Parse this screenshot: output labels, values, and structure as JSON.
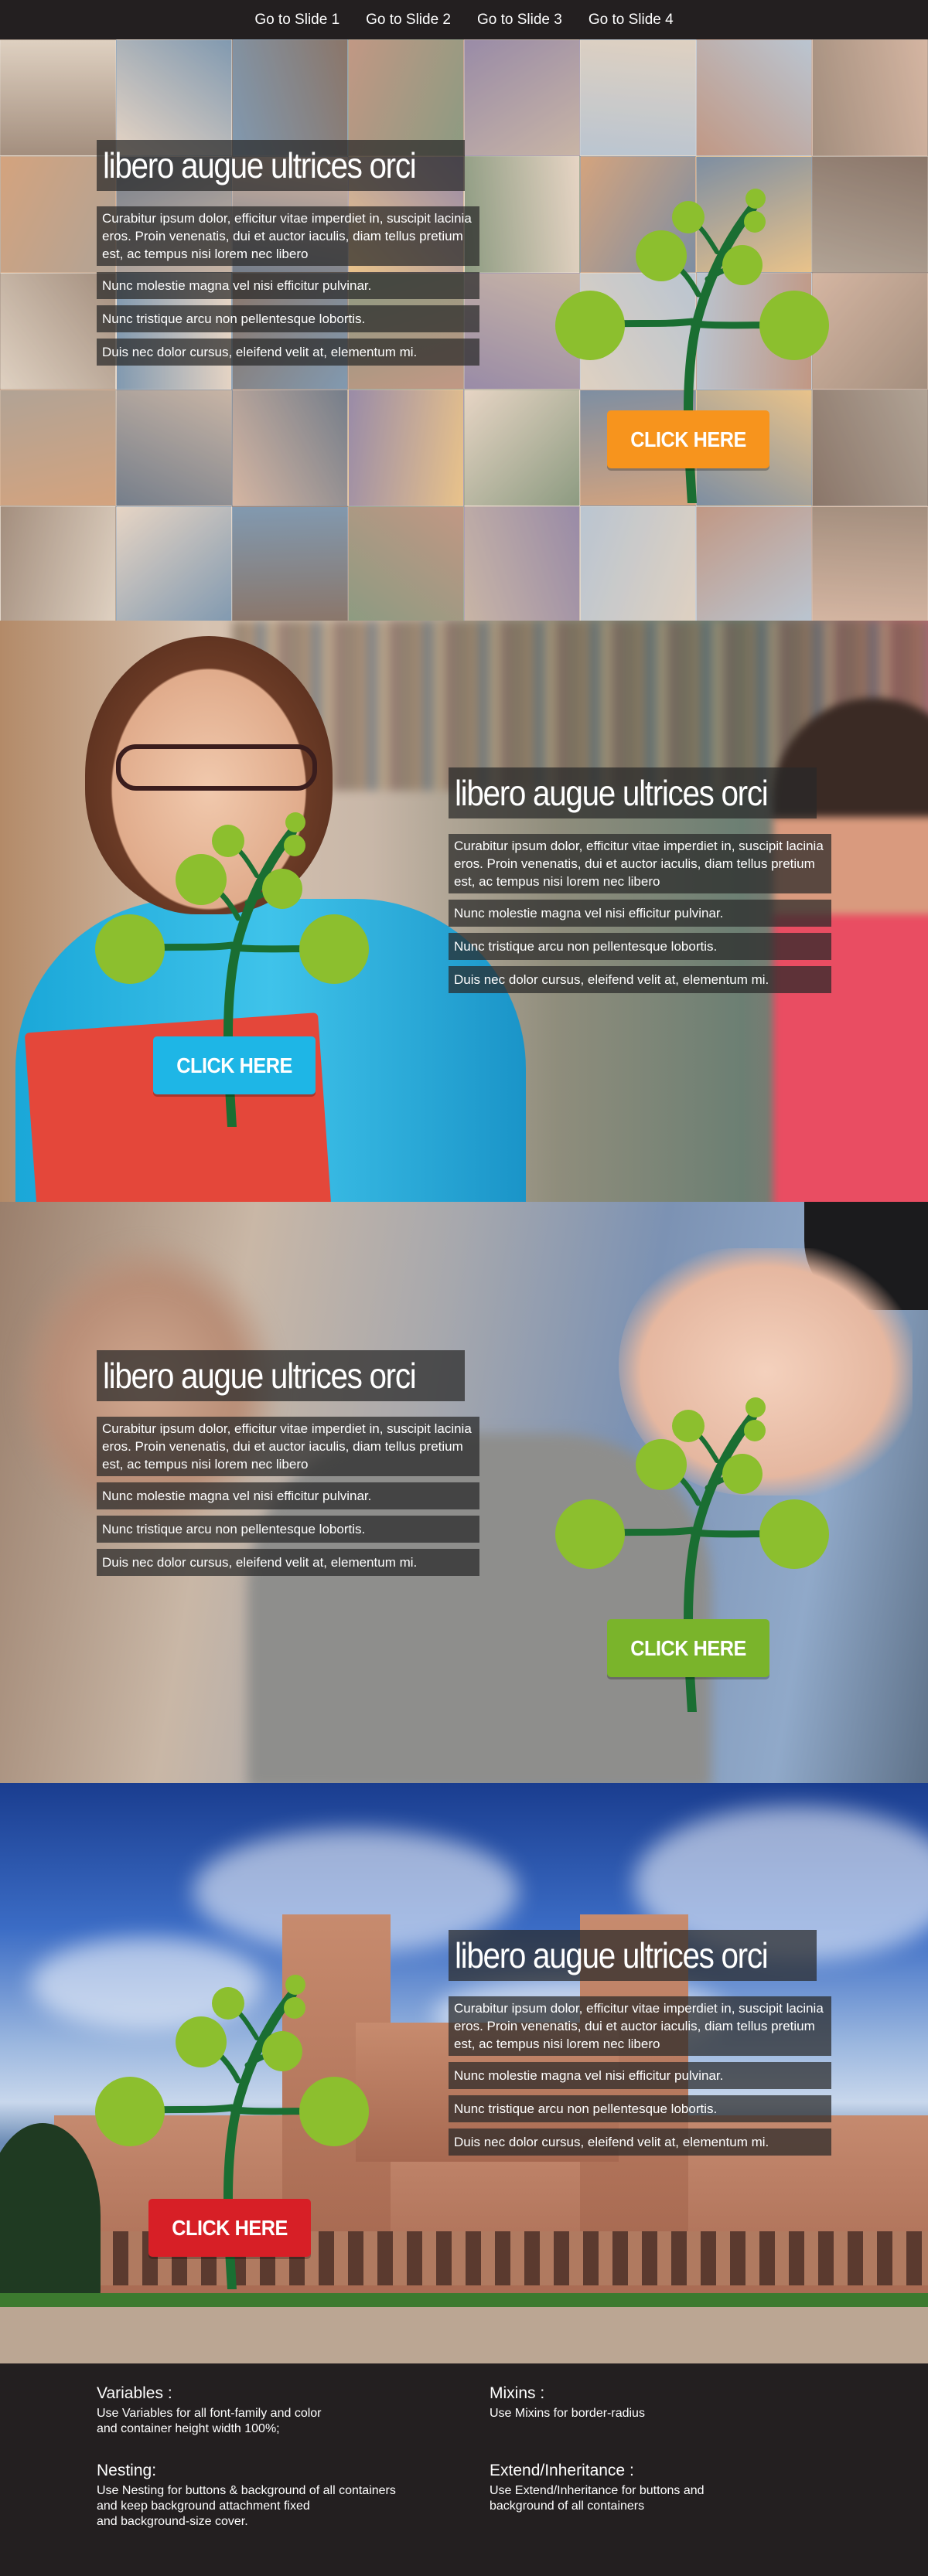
{
  "nav": [
    {
      "label": "Go to Slide 1"
    },
    {
      "label": "Go to Slide 2"
    },
    {
      "label": "Go to Slide 3"
    },
    {
      "label": "Go to Slide 4"
    }
  ],
  "slides": [
    {
      "title": "libero augue ultrices orci",
      "paragraph": "Curabitur ipsum dolor, efficitur vitae imperdiet in, suscipit lacinia eros. Proin venenatis, dui et auctor iaculis, diam tellus pretium est, ac tempus nisi lorem nec libero",
      "lines": [
        "Nunc molestie magna vel nisi efficitur pulvinar.",
        "Nunc tristique arcu non pellentesque lobortis.",
        "Duis nec dolor cursus, eleifend velit at, elementum mi."
      ],
      "button": "CLICK HERE",
      "button_color": "#f7941d"
    },
    {
      "title": "libero augue ultrices orci",
      "paragraph": "Curabitur ipsum dolor, efficitur vitae imperdiet in, suscipit lacinia eros. Proin venenatis, dui et auctor iaculis, diam tellus pretium est, ac tempus nisi lorem nec libero",
      "lines": [
        "Nunc molestie magna vel nisi efficitur pulvinar.",
        "Nunc tristique arcu non pellentesque lobortis.",
        "Duis nec dolor cursus, eleifend velit at, elementum mi."
      ],
      "button": "CLICK HERE",
      "button_color": "#1eb6e6"
    },
    {
      "title": "libero augue ultrices orci",
      "paragraph": "Curabitur ipsum dolor, efficitur vitae imperdiet in, suscipit lacinia eros. Proin venenatis, dui et auctor iaculis, diam tellus pretium est, ac tempus nisi lorem nec libero",
      "lines": [
        "Nunc molestie magna vel nisi efficitur pulvinar.",
        "Nunc tristique arcu non pellentesque lobortis.",
        "Duis nec dolor cursus, eleifend velit at, elementum mi."
      ],
      "button": "CLICK HERE",
      "button_color": "#7ab42b"
    },
    {
      "title": "libero augue ultrices orci",
      "paragraph": "Curabitur ipsum dolor, efficitur vitae imperdiet in, suscipit lacinia eros. Proin venenatis, dui et auctor iaculis, diam tellus pretium est, ac tempus nisi lorem nec libero",
      "lines": [
        "Nunc molestie magna vel nisi efficitur pulvinar.",
        "Nunc tristique arcu non pellentesque lobortis.",
        "Duis nec dolor cursus, eleifend velit at, elementum mi."
      ],
      "button": "CLICK HERE",
      "button_color": "#d71f26"
    }
  ],
  "colors": {
    "leaf": "#8cbf2e",
    "trunk": "#1a6e32",
    "dark_bg": "#231f20"
  },
  "footer": {
    "variables": {
      "heading": "Variables :",
      "text": "Use Variables for all font-family and color\nand container height width 100%;"
    },
    "mixins": {
      "heading": "Mixins :",
      "text": "Use Mixins for border-radius"
    },
    "nesting": {
      "heading": "Nesting:",
      "text": "Use Nesting for buttons  & background of all containers\nand keep background attachment fixed\nand background-size cover."
    },
    "extend": {
      "heading": "Extend/Inheritance :",
      "text": "Use Extend/Inheritance for buttons and\nbackground of all containers"
    }
  }
}
